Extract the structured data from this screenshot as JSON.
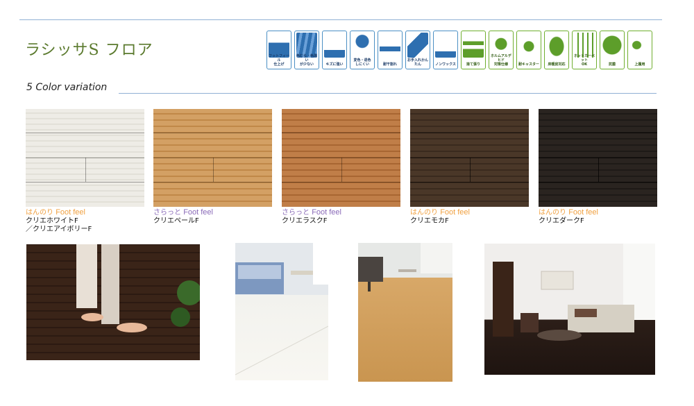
{
  "page": {
    "title": "ラシッサS フロア",
    "subtitle": "5 Color variation"
  },
  "icons": [
    {
      "label": "フットフィール\n仕上げ",
      "icon": "foot-feel-icon",
      "color": "#2e6fb0"
    },
    {
      "label": "色むら・色違い\nが少ない",
      "icon": "color-uniform-icon",
      "color": "#2e6fb0"
    },
    {
      "label": "キズに強い",
      "icon": "scratch-resistant-icon",
      "color": "#2e6fb0"
    },
    {
      "label": "変色・退色\nしにくい",
      "icon": "fade-resistant-icon",
      "color": "#2e6fb0"
    },
    {
      "label": "耐干割れ",
      "icon": "crack-resistant-icon",
      "color": "#2e6fb0"
    },
    {
      "label": "お手入れかんたん",
      "icon": "easy-care-icon",
      "color": "#2e6fb0"
    },
    {
      "label": "ノンワックス",
      "icon": "non-wax-icon",
      "color": "#2e6fb0"
    },
    {
      "label": "捨て張り",
      "icon": "underlay-icon",
      "color": "#5d9e2a"
    },
    {
      "label": "ホルムアルデヒド\n対策仕様",
      "icon": "formaldehyde-icon",
      "color": "#5d9e2a"
    },
    {
      "label": "耐キャスター",
      "icon": "caster-icon",
      "color": "#5d9e2a"
    },
    {
      "label": "床暖房対応",
      "icon": "floor-heating-icon",
      "color": "#5d9e2a"
    },
    {
      "label": "ホットカーペット\nOK",
      "icon": "hot-carpet-icon",
      "color": "#5d9e2a"
    },
    {
      "label": "抗菌",
      "icon": "antibacterial-icon",
      "color": "#5d9e2a"
    },
    {
      "label": "上履用",
      "icon": "indoor-shoes-icon",
      "color": "#5d9e2a"
    }
  ],
  "colors": [
    {
      "tag": "はんのり",
      "feel": "Foot feel",
      "name": "クリエホワイトF\n／クリエアイボリーF",
      "accent": "#f0a040",
      "base": "#eeece6",
      "base2": "#e2e0d8"
    },
    {
      "tag": "さらっと",
      "feel": "Foot feel",
      "name": "クリエペールF",
      "accent": "#8a6ab8",
      "base": "#d3a064",
      "base2": "#c08848"
    },
    {
      "tag": "さらっと",
      "feel": "Foot feel",
      "name": "クリエラスクF",
      "accent": "#8a6ab8",
      "base": "#c07e48",
      "base2": "#a86632"
    },
    {
      "tag": "はんのり",
      "feel": "Foot feel",
      "name": "クリエモカF",
      "accent": "#f0a040",
      "base": "#4a3728",
      "base2": "#3a2a1e"
    },
    {
      "tag": "はんのり",
      "feel": "Foot feel",
      "name": "クリエダークF",
      "accent": "#f0a040",
      "base": "#2a2420",
      "base2": "#1e1a17"
    }
  ]
}
